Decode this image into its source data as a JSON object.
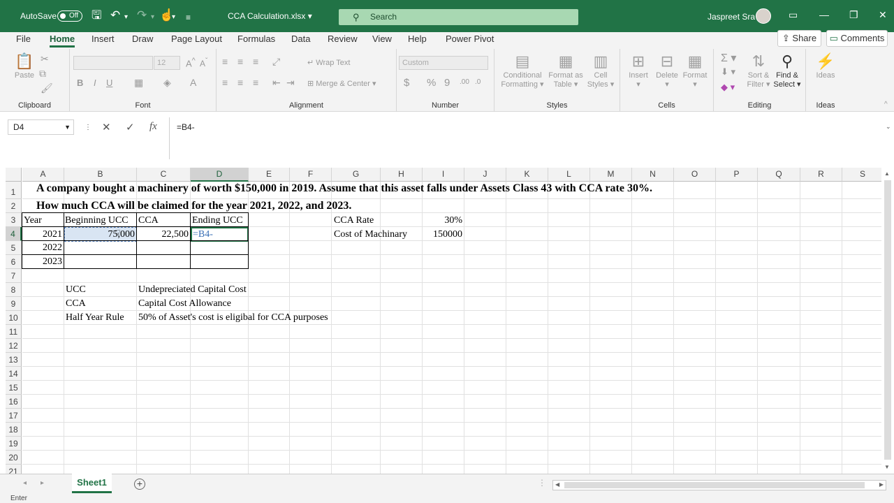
{
  "titlebar": {
    "autosave_label": "AutoSave",
    "autosave_state": "Off",
    "filename": "CCA Calculation.xlsx",
    "filename_caret": "▾",
    "search_placeholder": "Search",
    "user_name": "Jaspreet Sra",
    "accent_color": "#217346"
  },
  "menu": {
    "tabs": [
      "File",
      "Home",
      "Insert",
      "Draw",
      "Page Layout",
      "Formulas",
      "Data",
      "Review",
      "View",
      "Help",
      "Power Pivot"
    ],
    "active": "Home",
    "share": "Share",
    "comments": "Comments"
  },
  "ribbon": {
    "clipboard": {
      "label": "Clipboard",
      "paste": "Paste"
    },
    "font": {
      "label": "Font",
      "size": "12",
      "bold": "B",
      "italic": "I",
      "underline": "U"
    },
    "alignment": {
      "label": "Alignment",
      "wrap": "Wrap Text",
      "merge": "Merge & Center"
    },
    "number": {
      "label": "Number",
      "format": "Custom",
      "currency": "$",
      "percent": "%",
      "comma": "9",
      "inc_dec": ".00",
      "dec_dec": ".0"
    },
    "styles": {
      "label": "Styles",
      "cond1": "Conditional",
      "cond2": "Formatting",
      "fmt1": "Format as",
      "fmt2": "Table",
      "cell1": "Cell",
      "cell2": "Styles"
    },
    "cells": {
      "label": "Cells",
      "insert": "Insert",
      "delete": "Delete",
      "format": "Format"
    },
    "editing": {
      "label": "Editing",
      "sort1": "Sort &",
      "sort2": "Filter",
      "find1": "Find &",
      "find2": "Select"
    },
    "ideas": {
      "label": "Ideas",
      "ideas": "Ideas"
    }
  },
  "formula_bar": {
    "name_box": "D4",
    "cancel": "✕",
    "enter": "✓",
    "fx": "fx",
    "formula": "=B4-"
  },
  "sheet": {
    "columns": [
      "A",
      "B",
      "C",
      "D",
      "E",
      "F",
      "G",
      "H",
      "I",
      "J",
      "K",
      "L",
      "M",
      "N",
      "O",
      "P",
      "Q",
      "R",
      "S"
    ],
    "rows": [
      "1",
      "2",
      "3",
      "4",
      "5",
      "6",
      "7",
      "8",
      "9",
      "10",
      "11",
      "12",
      "13",
      "14",
      "15",
      "16",
      "17",
      "18",
      "19",
      "20",
      "21"
    ],
    "selected_column": "D",
    "selected_row": "4",
    "title_line1": "A company bought a machinery of worth $150,000 in 2019. Assume that this asset falls under Assets Class 43 with CCA rate 30%.",
    "title_line2": "How much CCA will be claimed for the year 2021, 2022, and 2023.",
    "table": {
      "headers": [
        "Year",
        "Beginning UCC",
        "CCA",
        "Ending UCC"
      ],
      "years": [
        "2021",
        "2022",
        "2023"
      ],
      "beginning_ucc_2021": "75,000",
      "cca_2021": "22,500",
      "ending_ucc_2021_edit": "=B4-"
    },
    "params": {
      "cca_rate_label": "CCA Rate",
      "cca_rate_value": "30%",
      "cost_label": "Cost of Machinary",
      "cost_value": "150000"
    },
    "glossary": [
      {
        "term": "UCC",
        "definition": "Undepreciated Capital Cost"
      },
      {
        "term": "CCA",
        "definition": "Capital Cost Allowance"
      },
      {
        "term": "Half Year Rule",
        "definition": "50% of Asset's cost is eligibal for CCA purposes"
      }
    ]
  },
  "sheet_tabs": {
    "active": "Sheet1",
    "add": "+"
  },
  "status": {
    "mode": "Enter"
  }
}
